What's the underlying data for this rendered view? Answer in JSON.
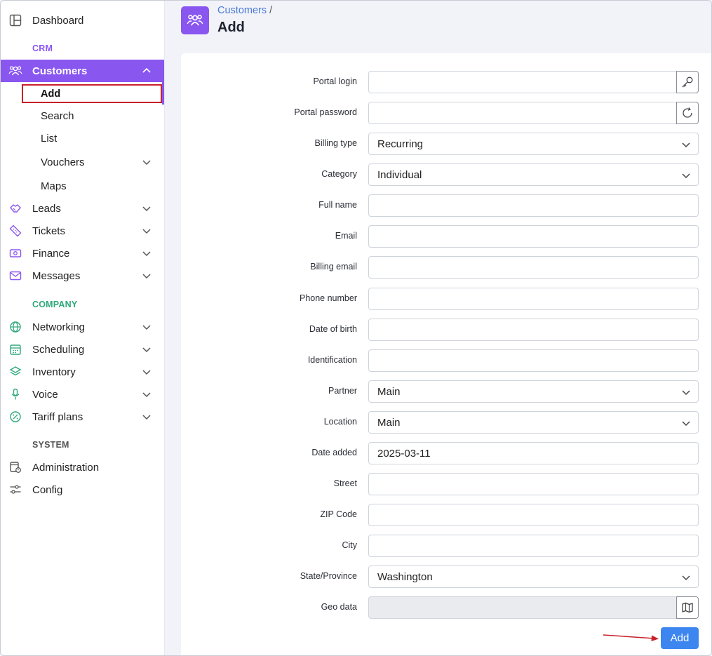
{
  "sidebar": {
    "dashboard": "Dashboard",
    "sections": {
      "crm": "CRM",
      "company": "COMPANY",
      "system": "SYSTEM"
    },
    "customers": "Customers",
    "customers_sub": {
      "add": "Add",
      "search": "Search",
      "list": "List",
      "vouchers": "Vouchers",
      "maps": "Maps"
    },
    "crm_items": [
      "Leads",
      "Tickets",
      "Finance",
      "Messages"
    ],
    "company_items": [
      "Networking",
      "Scheduling",
      "Inventory",
      "Voice",
      "Tariff plans"
    ],
    "system_items": [
      "Administration",
      "Config"
    ]
  },
  "header": {
    "breadcrumb": "Customers",
    "separator": "/",
    "title": "Add"
  },
  "form": {
    "labels": {
      "portal_login": "Portal login",
      "portal_password": "Portal password",
      "billing_type": "Billing type",
      "category": "Category",
      "full_name": "Full name",
      "email": "Email",
      "billing_email": "Billing email",
      "phone_number": "Phone number",
      "date_of_birth": "Date of birth",
      "identification": "Identification",
      "partner": "Partner",
      "location": "Location",
      "date_added": "Date added",
      "street": "Street",
      "zip_code": "ZIP Code",
      "city": "City",
      "state_province": "State/Province",
      "geo_data": "Geo data"
    },
    "values": {
      "portal_login": "",
      "portal_password": "",
      "billing_type": "Recurring",
      "category": "Individual",
      "full_name": "",
      "email": "",
      "billing_email": "",
      "phone_number": "",
      "date_of_birth": "",
      "identification": "",
      "partner": "Main",
      "location": "Main",
      "date_added": "2025-03-11",
      "street": "",
      "zip_code": "",
      "city": "",
      "state_province": "Washington",
      "geo_data": ""
    },
    "submit_label": "Add"
  },
  "colors": {
    "accent": "#8a56f0",
    "crm_section": "#8a56f0",
    "company_section": "#2ea87a",
    "system_section": "#555555",
    "primary_button": "#3d86f0",
    "highlight_box": "#c8202a"
  }
}
